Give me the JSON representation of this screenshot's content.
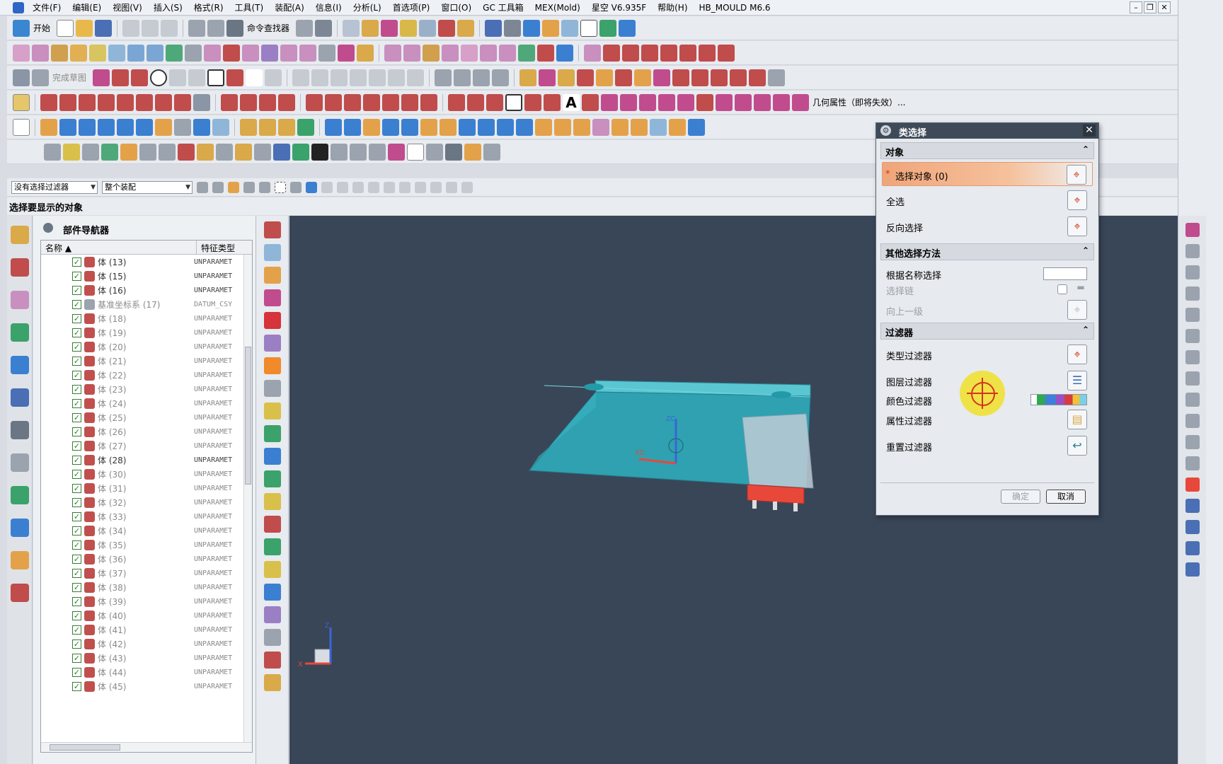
{
  "menubar": {
    "items": [
      "文件(F)",
      "编辑(E)",
      "视图(V)",
      "插入(S)",
      "格式(R)",
      "工具(T)",
      "装配(A)",
      "信息(I)",
      "分析(L)",
      "首选项(P)",
      "窗口(O)",
      "GC 工具箱",
      "MEX(Mold)",
      "星空 V6.935F",
      "帮助(H)",
      "HB_MOULD M6.6"
    ]
  },
  "toolbar": {
    "start_label": "开始",
    "command_finder_label": "命令查找器",
    "sketch_finish_label": "完成草图",
    "geometry_props_label": "几何属性（即将失效）..."
  },
  "filter": {
    "type_filter_value": "没有选择过滤器",
    "scope_value": "整个装配"
  },
  "status": {
    "prompt": "选择要显示的对象"
  },
  "navigator": {
    "title": "部件导航器",
    "col_name": "名称",
    "col_type": "特征类型",
    "rows": [
      {
        "name": "体 (13)",
        "type": "UNPARAMET",
        "gray": false
      },
      {
        "name": "体 (15)",
        "type": "UNPARAMET",
        "gray": false
      },
      {
        "name": "体 (16)",
        "type": "UNPARAMET",
        "gray": false
      },
      {
        "name": "基准坐标系 (17)",
        "type": "DATUM_CSY",
        "gray": true
      },
      {
        "name": "体 (18)",
        "type": "UNPARAMET",
        "gray": true
      },
      {
        "name": "体 (19)",
        "type": "UNPARAMET",
        "gray": true
      },
      {
        "name": "体 (20)",
        "type": "UNPARAMET",
        "gray": true
      },
      {
        "name": "体 (21)",
        "type": "UNPARAMET",
        "gray": true
      },
      {
        "name": "体 (22)",
        "type": "UNPARAMET",
        "gray": true
      },
      {
        "name": "体 (23)",
        "type": "UNPARAMET",
        "gray": true
      },
      {
        "name": "体 (24)",
        "type": "UNPARAMET",
        "gray": true
      },
      {
        "name": "体 (25)",
        "type": "UNPARAMET",
        "gray": true
      },
      {
        "name": "体 (26)",
        "type": "UNPARAMET",
        "gray": true
      },
      {
        "name": "体 (27)",
        "type": "UNPARAMET",
        "gray": true
      },
      {
        "name": "体 (28)",
        "type": "UNPARAMET",
        "gray": false
      },
      {
        "name": "体 (30)",
        "type": "UNPARAMET",
        "gray": true
      },
      {
        "name": "体 (31)",
        "type": "UNPARAMET",
        "gray": true
      },
      {
        "name": "体 (32)",
        "type": "UNPARAMET",
        "gray": true
      },
      {
        "name": "体 (33)",
        "type": "UNPARAMET",
        "gray": true
      },
      {
        "name": "体 (34)",
        "type": "UNPARAMET",
        "gray": true
      },
      {
        "name": "体 (35)",
        "type": "UNPARAMET",
        "gray": true
      },
      {
        "name": "体 (36)",
        "type": "UNPARAMET",
        "gray": true
      },
      {
        "name": "体 (37)",
        "type": "UNPARAMET",
        "gray": true
      },
      {
        "name": "体 (38)",
        "type": "UNPARAMET",
        "gray": true
      },
      {
        "name": "体 (39)",
        "type": "UNPARAMET",
        "gray": true
      },
      {
        "name": "体 (40)",
        "type": "UNPARAMET",
        "gray": true
      },
      {
        "name": "体 (41)",
        "type": "UNPARAMET",
        "gray": true
      },
      {
        "name": "体 (42)",
        "type": "UNPARAMET",
        "gray": true
      },
      {
        "name": "体 (43)",
        "type": "UNPARAMET",
        "gray": true
      },
      {
        "name": "体 (44)",
        "type": "UNPARAMET",
        "gray": true
      },
      {
        "name": "体 (45)",
        "type": "UNPARAMET",
        "gray": true
      }
    ]
  },
  "dialog": {
    "title": "类选择",
    "group_object": "对象",
    "select_object": "选择对象 (0)",
    "select_all": "全选",
    "invert_selection": "反向选择",
    "group_other": "其他选择方法",
    "select_by_name": "根据名称选择",
    "select_chain": "选择链",
    "up_one_level": "向上一级",
    "group_filter": "过滤器",
    "type_filter": "类型过滤器",
    "layer_filter": "图层过滤器",
    "color_filter": "颜色过滤器",
    "attribute_filter": "属性过滤器",
    "reset_filter": "重置过滤器",
    "ok": "确定",
    "cancel": "取消"
  },
  "triad": {
    "x": "X",
    "z": "Z",
    "zc": "ZC",
    "xc": "XC"
  },
  "colors": {
    "part_body": "#2fa6b5",
    "part_accent": "#e8483a",
    "background": "#394658",
    "selection_highlight": "#f0a57a"
  }
}
